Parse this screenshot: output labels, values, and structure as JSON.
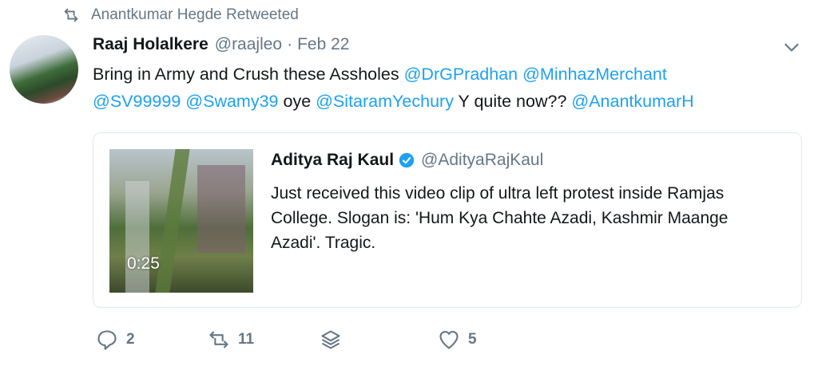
{
  "retweet_context": {
    "text": "Anantkumar Hegde Retweeted",
    "icon": "retweet-icon"
  },
  "tweet": {
    "author_name": "Raaj Holalkere",
    "author_handle": "@raajleo",
    "separator": "·",
    "time": "Feb 22",
    "text_parts": {
      "p1": "Bring in Army and Crush these Assholes ",
      "m1": "@DrGPradhan",
      "s1": " ",
      "m2": "@MinhazMerchant",
      "s2": " ",
      "m3": "@SV99999",
      "s3": " ",
      "m4": "@Swamy39",
      "p2": " oye ",
      "m5": "@SitaramYechury",
      "p3": " Y quite now?? ",
      "m6": "@AnantkumarH"
    }
  },
  "quote": {
    "author_name": "Aditya Raj Kaul",
    "author_handle": "@AdityaRajKaul",
    "verified_icon": "verified-badge-icon",
    "text": "Just received this video clip of ultra left protest inside Ramjas College. Slogan is: 'Hum Kya Chahte Azadi, Kashmir Maange Azadi'. Tragic.",
    "video_duration": "0:25"
  },
  "actions": {
    "reply_count": "2",
    "retweet_count": "11",
    "like_count": "5"
  },
  "colors": {
    "link": "#1da1f2",
    "secondary": "#657786",
    "text": "#14171a",
    "border": "#e1e8ed",
    "verified": "#1da1f2"
  }
}
